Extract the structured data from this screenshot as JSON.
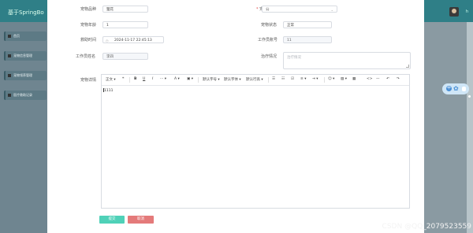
{
  "app": {
    "title": "基于SpringBo",
    "user_name": "h"
  },
  "sidebar": {
    "items": [
      {
        "label": "首页"
      },
      {
        "label": "宠物信息管理"
      },
      {
        "label": "宠物领养管理"
      },
      {
        "label": "医疗救助记录"
      }
    ]
  },
  "form": {
    "pet_name": {
      "label": "宠物品种",
      "value": "狸花"
    },
    "pet_gender": {
      "label": "宠物性别",
      "value": "公"
    },
    "pet_age": {
      "label": "宠物年龄",
      "value": "1"
    },
    "pet_status": {
      "label": "宠物状态",
      "value": "正常"
    },
    "treat_time": {
      "label": "救助时间",
      "value": "2024-11-17 22:45:13"
    },
    "worker_no": {
      "label": "工作员账号",
      "value": "11"
    },
    "worker_name": {
      "label": "工作员姓名",
      "value": "李四"
    },
    "treatment": {
      "label": "治疗情况",
      "placeholder": "治疗情况"
    },
    "detail": {
      "label": "宠物详情",
      "content": "1111"
    }
  },
  "toolbar": {
    "para": "正文",
    "quote": "❝",
    "bold": "B",
    "underline": "U",
    "italic": "I",
    "more": "···",
    "fontcolor": "A",
    "bgcolor": "▣",
    "fontsize": "默认字号",
    "fontfamily": "默认字体",
    "lineheight": "默认行高",
    "bullet": "☰",
    "numbered": "☷",
    "todo": "☑",
    "align": "≡",
    "indent": "⇥",
    "emoji": "☺",
    "image": "▨",
    "code": "<>",
    "hr": "—",
    "undo": "↶",
    "redo": "↷"
  },
  "buttons": {
    "confirm": "提交",
    "cancel": "取消"
  },
  "float_widget": {
    "a": "中",
    "b": "✿"
  },
  "watermark": "CSDN @QQ_2079523559"
}
